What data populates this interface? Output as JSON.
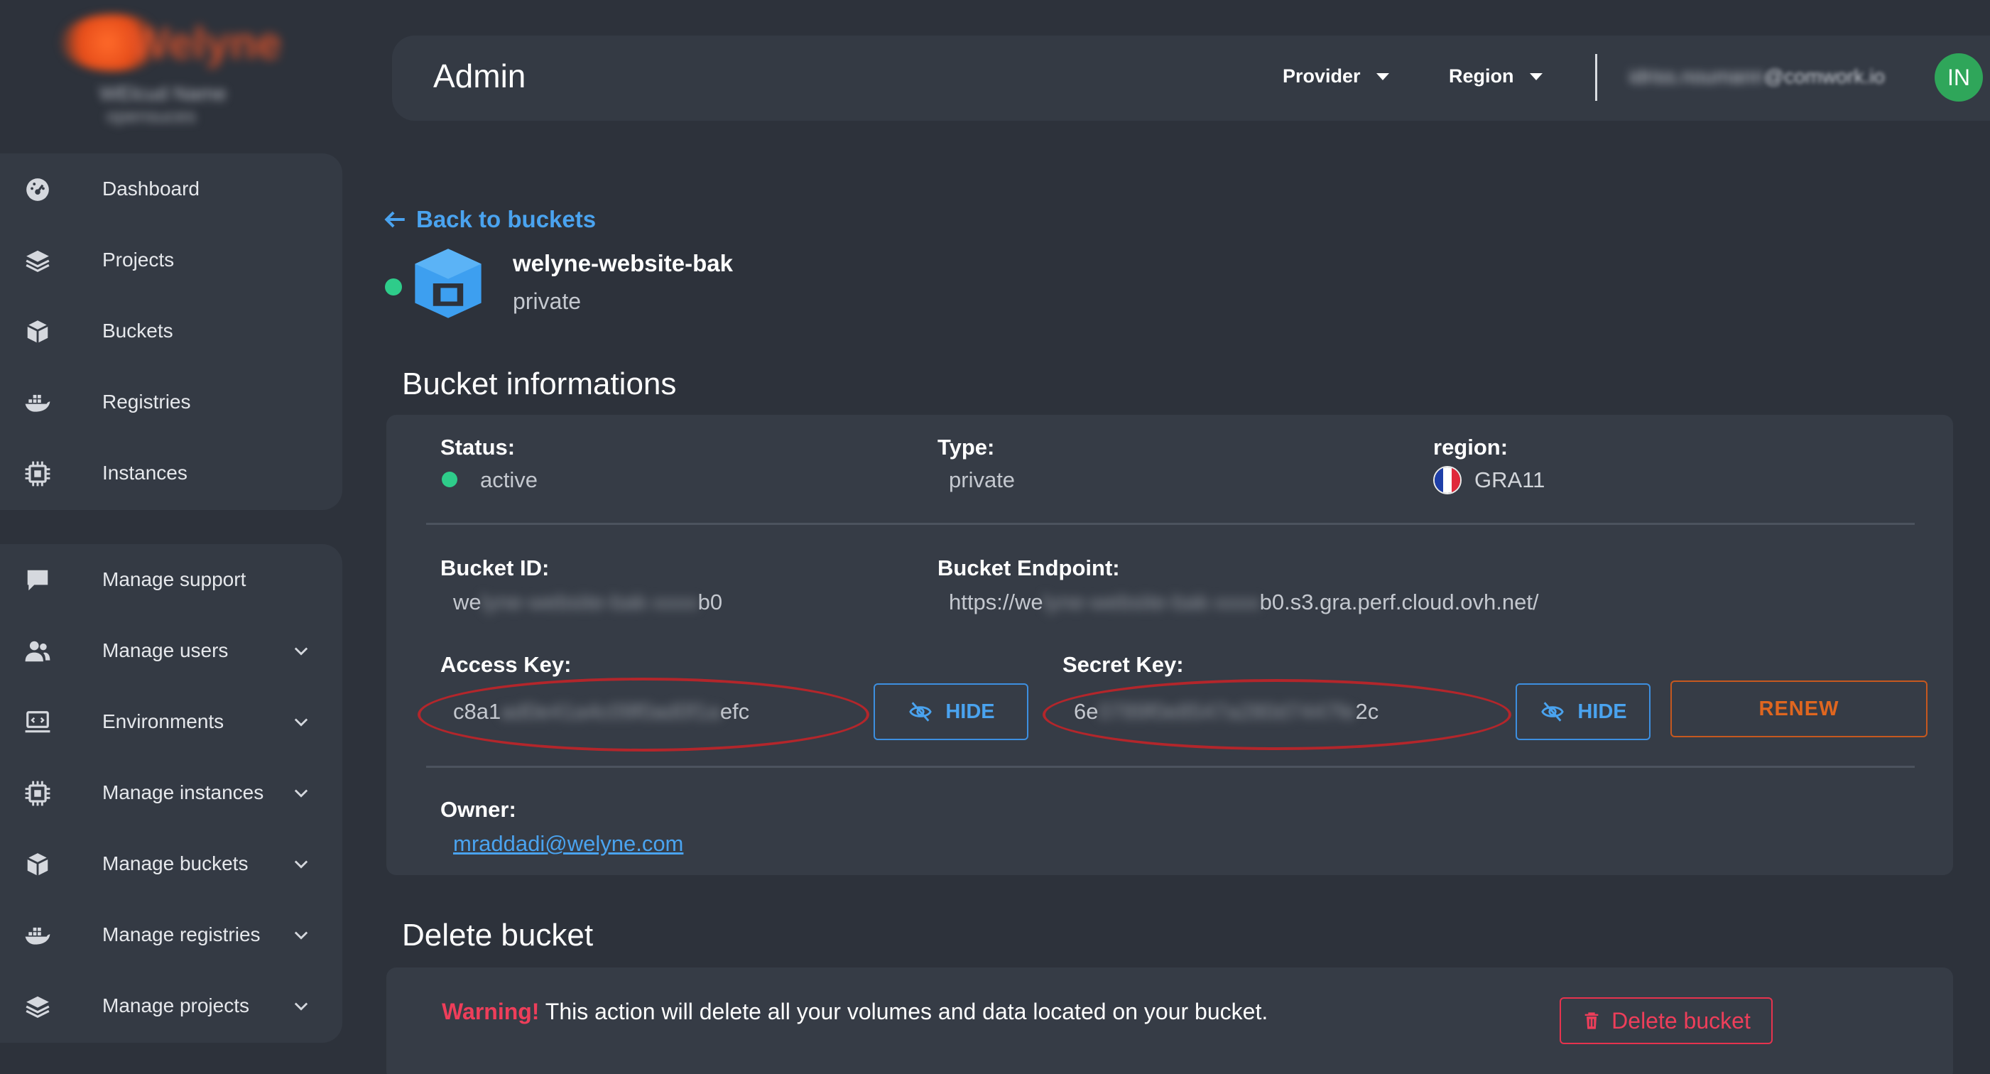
{
  "brand": {
    "name": "Welyne",
    "subtitle": "WElcud Name",
    "subtitle2": "opensuces"
  },
  "sidebar": {
    "group1": [
      {
        "label": "Dashboard",
        "icon": "dashboard-icon"
      },
      {
        "label": "Projects",
        "icon": "layers-icon"
      },
      {
        "label": "Buckets",
        "icon": "cube-icon"
      },
      {
        "label": "Registries",
        "icon": "docker-icon"
      },
      {
        "label": "Instances",
        "icon": "chip-icon"
      }
    ],
    "group2": [
      {
        "label": "Manage support",
        "icon": "chat-icon"
      },
      {
        "label": "Manage users",
        "icon": "users-icon"
      },
      {
        "label": "Environments",
        "icon": "laptop-icon"
      },
      {
        "label": "Manage instances",
        "icon": "chip-icon"
      },
      {
        "label": "Manage buckets",
        "icon": "cube-icon"
      },
      {
        "label": "Manage registries",
        "icon": "docker-icon"
      },
      {
        "label": "Manage projects",
        "icon": "layers-icon"
      }
    ]
  },
  "topbar": {
    "title": "Admin",
    "provider_label": "Provider",
    "region_label": "Region",
    "email_hidden": "idriss.noumann",
    "email_domain": "@comwork.io",
    "avatar_initials": "IN",
    "avatar_color": "#2fa65a"
  },
  "back_link": "Back to buckets",
  "bucket": {
    "name": "welyne-website-bak",
    "visibility": "private",
    "status_color": "#2ecc8a"
  },
  "info": {
    "section_title": "Bucket informations",
    "status_label": "Status:",
    "status_value": "active",
    "type_label": "Type:",
    "type_value": "private",
    "region_label": "region:",
    "region_value": "GRA11",
    "bucket_id_label": "Bucket ID:",
    "bucket_id_start": "we",
    "bucket_id_hidden": "lyne-website-bak-xxxx",
    "bucket_id_end": "b0",
    "endpoint_label": "Bucket Endpoint:",
    "endpoint_start": "https://we",
    "endpoint_hidden": "lyne-website-bak-xxxx",
    "endpoint_end": "b0.s3.gra.perf.cloud.ovh.net/",
    "access_key_label": "Access Key:",
    "access_key_start": "c8a1",
    "access_key_hidden": "ad0e41a4c09f0ad0f1a",
    "access_key_end": "efc",
    "secret_key_label": "Secret Key:",
    "secret_key_start": "6e",
    "secret_key_hidden": "0789f0e8547a280d7447fe",
    "secret_key_end": "2c",
    "hide_label": "HIDE",
    "renew_label": "RENEW",
    "owner_label": "Owner:",
    "owner_email": "mraddadi@welyne.com"
  },
  "delete": {
    "section_title": "Delete bucket",
    "warning_prefix": "Warning!",
    "warning_text": " This action will delete all your volumes and data located on your bucket.",
    "button_label": "Delete bucket"
  }
}
